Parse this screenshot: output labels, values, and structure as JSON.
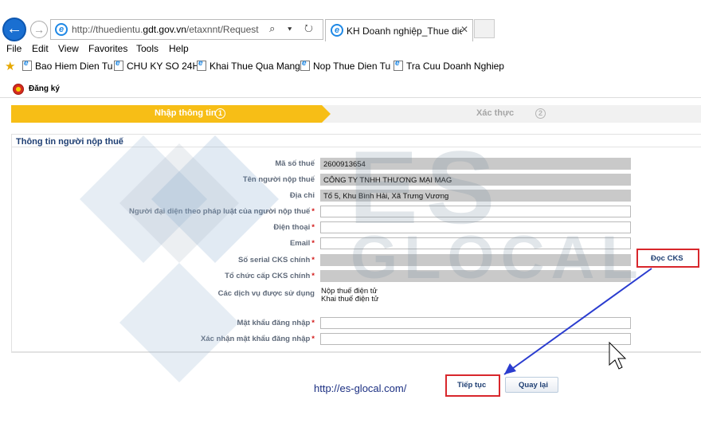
{
  "browser": {
    "url_prefix": "http://thuedientu.",
    "url_domain": "gdt.gov.vn",
    "url_path": "/etaxnnt/Request",
    "tab_title": "KH Doanh nghiệp_Thue die...",
    "address_icons": "⌕ ▾ ↻"
  },
  "menu": [
    "File",
    "Edit",
    "View",
    "Favorites",
    "Tools",
    "Help"
  ],
  "favorites": [
    "Bao Hiem Dien Tu",
    "CHU KY SO 24H",
    "Khai Thue Qua Mang",
    "Nop Thue Dien Tu",
    "Tra Cuu Doanh Nghiep"
  ],
  "page": {
    "header_label": "Đăng ký",
    "steps": [
      {
        "label": "Nhập thông tin",
        "num": "1"
      },
      {
        "label": "Xác thực",
        "num": "2"
      }
    ],
    "section_title": "Thông tin người nộp thuế",
    "fields": {
      "ma_so_thue": {
        "label": "Mã số thuế",
        "value": "2600913654"
      },
      "ten_nnt": {
        "label": "Tên người nộp thuế",
        "value": "CÔNG TY TNHH THƯƠNG MẠI MAG"
      },
      "dia_chi": {
        "label": "Địa chỉ",
        "value": "Tổ 5, Khu Bình Hải, Xã Trưng Vương"
      },
      "nguoi_dai_dien": {
        "label": "Người đại diện theo pháp luật của người nộp thuế",
        "value": ""
      },
      "dien_thoai": {
        "label": "Điện thoại",
        "value": ""
      },
      "email": {
        "label": "Email",
        "value": ""
      },
      "so_serial": {
        "label": "Số serial CKS chính",
        "value": ""
      },
      "to_chuc": {
        "label": "Tổ chức cấp CKS chính",
        "value": ""
      },
      "dich_vu": {
        "label": "Các dịch vụ được sử dụng",
        "items": [
          "Nộp thuế điện tử",
          "Khai thuế điện tử"
        ]
      },
      "mat_khau": {
        "label": "Mật khẩu đăng nhập",
        "value": ""
      },
      "xac_nhan": {
        "label": "Xác nhận mật khẩu đăng nhập",
        "value": ""
      }
    },
    "required_mark": "*",
    "doc_cks_label": "Đọc CKS",
    "next_label": "Tiếp tục",
    "back_label": "Quay lại",
    "website": "http://es-glocal.com/"
  },
  "watermark": {
    "line1": "ES",
    "line2": "GLOCAL"
  },
  "colors": {
    "accent": "#f7be16",
    "highlight": "#d8272c",
    "arrow": "#2a3ccf",
    "link": "#1b2f82"
  }
}
